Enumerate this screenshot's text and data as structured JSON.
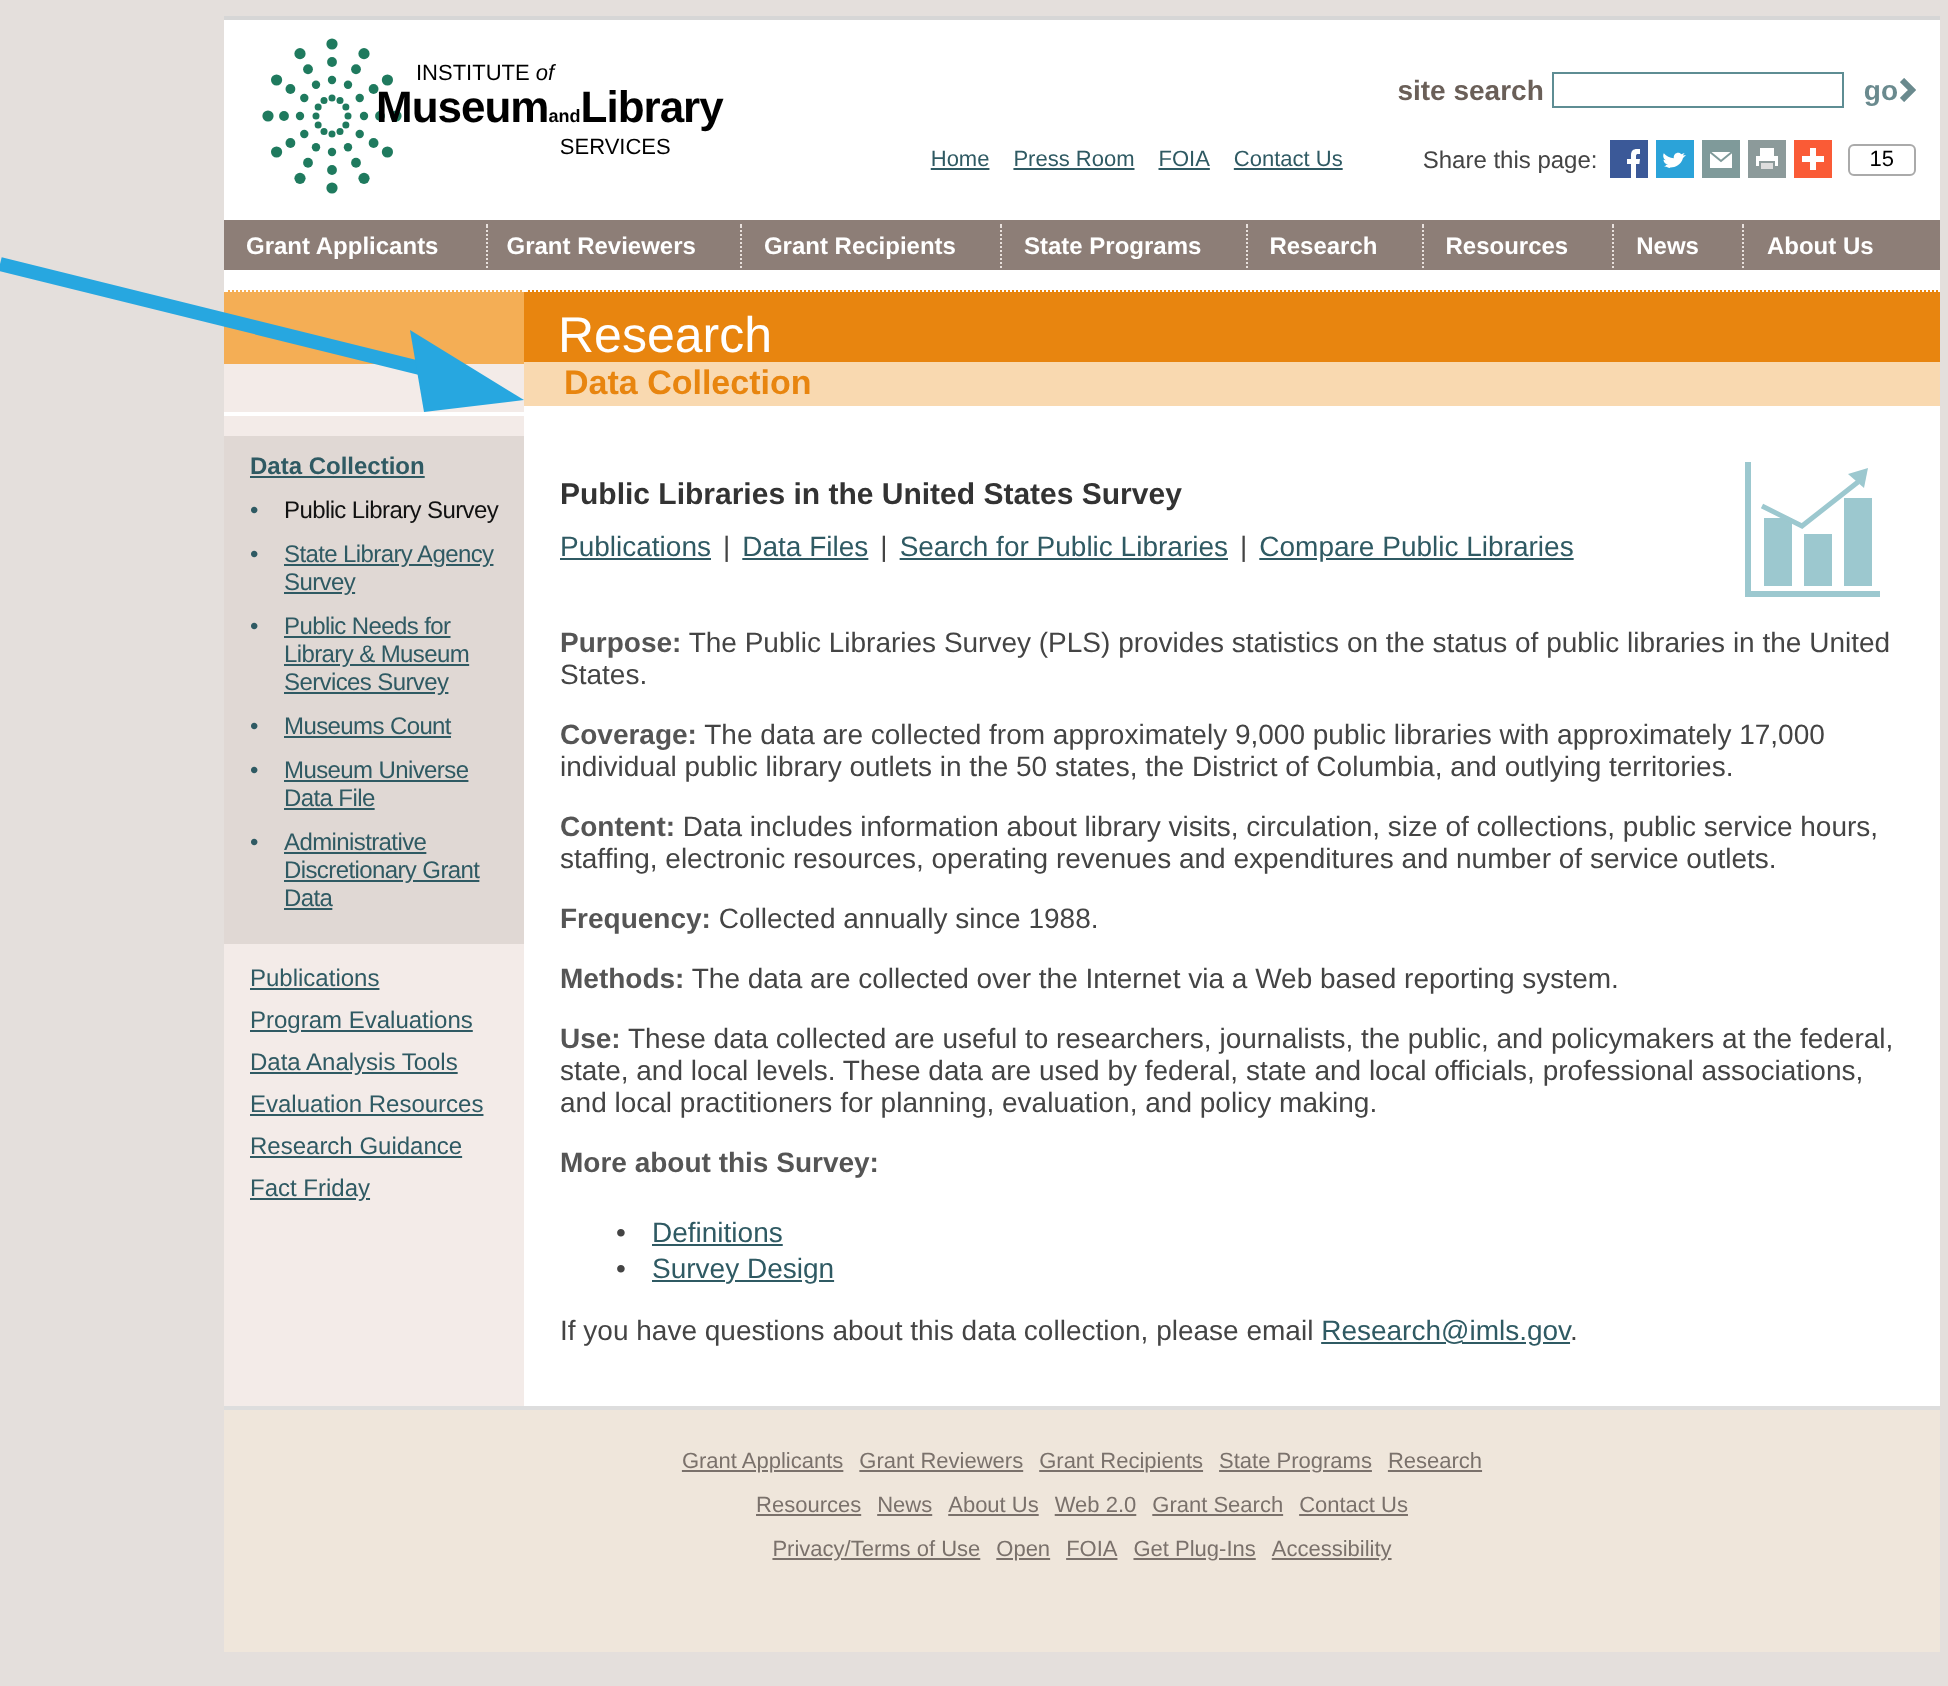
{
  "logo": {
    "line1": "INSTITUTE *of*",
    "word1": "Museum",
    "joiner": "and",
    "word2": "Library",
    "line3": "SERVICES"
  },
  "search": {
    "label": "site search",
    "button": "go"
  },
  "top_links": [
    "Home",
    "Press Room",
    "FOIA",
    "Contact Us"
  ],
  "share": {
    "label": "Share this page:",
    "count": "15"
  },
  "nav": [
    "Grant Applicants",
    "Grant Reviewers",
    "Grant Recipients",
    "State Programs",
    "Research",
    "Resources",
    "News",
    "About Us"
  ],
  "banner": {
    "title": "Research",
    "subtitle": "Data Collection"
  },
  "sidebar": {
    "heading": "Data Collection",
    "bullet": "•",
    "items": [
      {
        "label": "Public Library Survey",
        "selected": true
      },
      {
        "label": "State Library Agency Survey",
        "selected": false
      },
      {
        "label": "Public Needs for Library & Museum Services Survey",
        "selected": false
      },
      {
        "label": "Museums Count",
        "selected": false
      },
      {
        "label": "Museum Universe Data File",
        "selected": false
      },
      {
        "label": "Administrative Discretionary Grant Data",
        "selected": false
      }
    ],
    "links": [
      "Publications",
      "Program Evaluations",
      "Data Analysis Tools",
      "Evaluation Resources",
      "Research Guidance",
      "Fact Friday"
    ]
  },
  "content": {
    "title": "Public Libraries in the United States Survey",
    "links": [
      "Publications",
      "Data Files",
      "Search for Public Libraries",
      "Compare Public Libraries"
    ],
    "separator": "|",
    "bullet": "•",
    "paragraphs": [
      "**Purpose:** The Public Libraries Survey (PLS) provides statistics on the status of public libraries in the United States.",
      "**Coverage:** The data are collected from approximately 9,000 public libraries with approximately 17,000 individual public library outlets in the 50 states, the District of Columbia, and outlying territories.",
      "**Content:** Data includes information about library visits, circulation, size of collections, public service hours, staffing, electronic resources, operating revenues and expenditures and number of service outlets.",
      "**Frequency:** Collected annually since 1988.",
      "**Methods:** The data are collected over the Internet via a Web based reporting system.",
      "**Use:** These data collected are useful to researchers, journalists, the public, and policymakers at the federal, state, and local levels. These data are used by federal, state and local officials, professional associations, and local practitioners for planning, evaluation, and policy making."
    ],
    "more_heading": "More about this Survey:",
    "more_links": [
      "Definitions",
      "Survey Design"
    ],
    "contact_text": "If you have questions about this data collection, please email",
    "contact_link": "Research@imls.gov",
    "contact_end": "."
  },
  "footer": [
    [
      "Grant Applicants",
      "Grant Reviewers",
      "Grant Recipients",
      "State Programs",
      "Research"
    ],
    [
      "Resources",
      "News",
      "About Us",
      "Web 2.0",
      "Grant Search",
      "Contact Us"
    ],
    [
      "Privacy/Terms of Use",
      "Open",
      "FOIA",
      "Get Plug-Ins",
      "Accessibility"
    ]
  ]
}
